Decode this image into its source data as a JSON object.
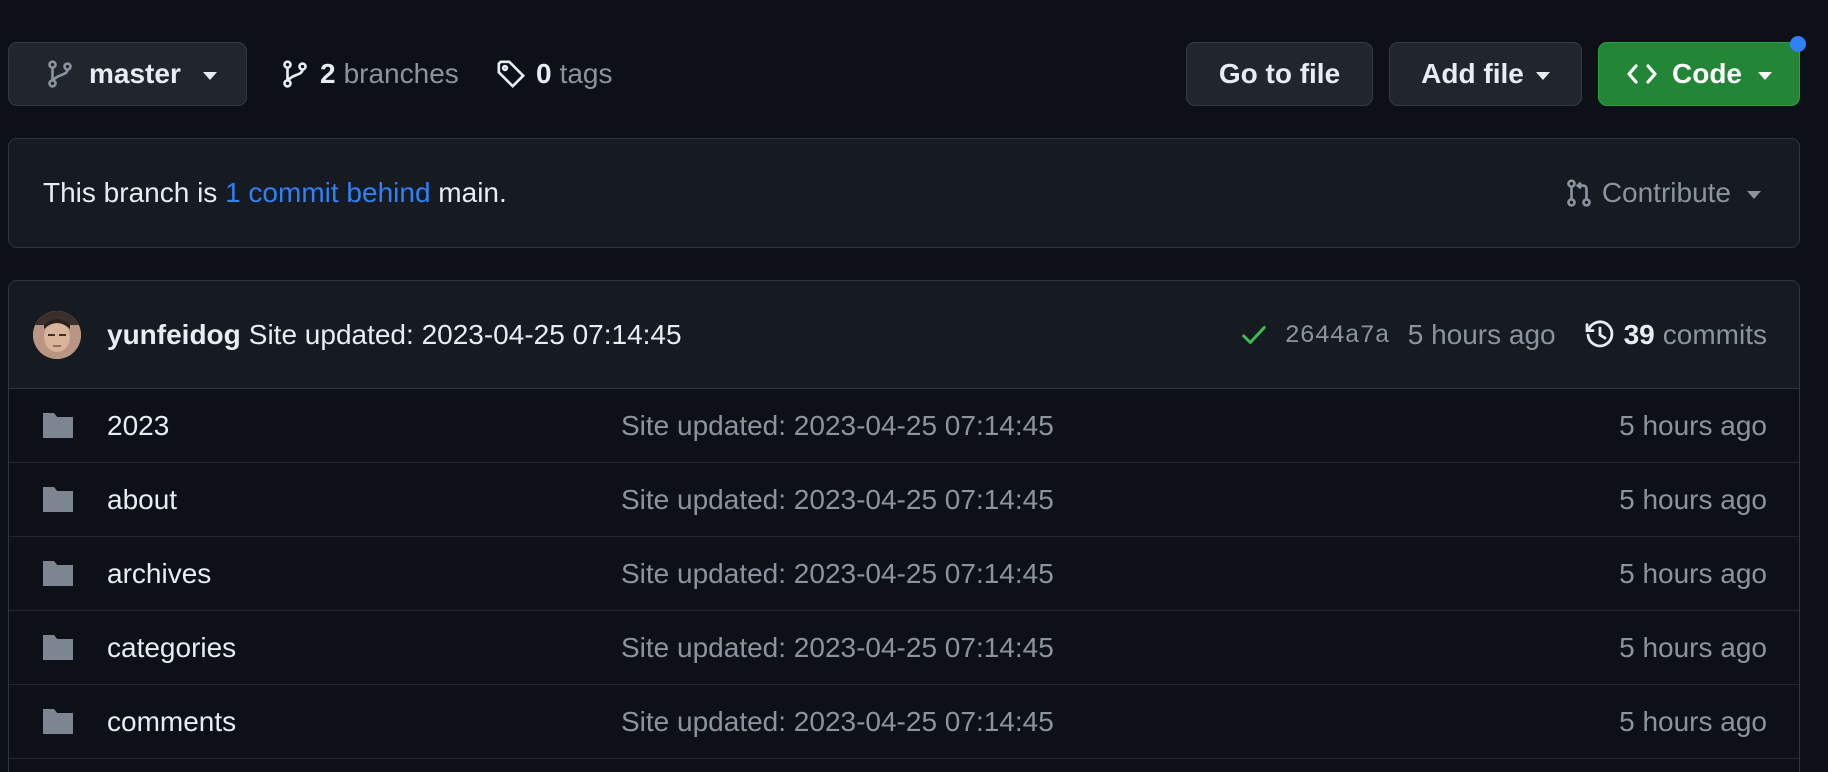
{
  "colors": {
    "background": "#0d1117",
    "panel": "#161b22",
    "accent_link": "#2f81f7",
    "code_button": "#238636",
    "success_check": "#3fb950",
    "folder_icon": "#7d8590"
  },
  "toolbar": {
    "branch_icon": "git-branch-icon",
    "branch_name": "master",
    "branches_count": "2",
    "branches_label": "branches",
    "tags_icon": "tag-icon",
    "tags_count": "0",
    "tags_label": "tags",
    "goto_file_label": "Go to file",
    "add_file_label": "Add file",
    "code_icon": "code-brackets-icon",
    "code_label": "Code"
  },
  "branch_status": {
    "prefix": "This branch is",
    "link": "1 commit behind",
    "suffix": "main.",
    "contribute_icon": "pull-request-icon",
    "contribute_label": "Contribute"
  },
  "latest_commit": {
    "author": "yunfeidog",
    "message": "Site updated: 2023-04-25 07:14:45",
    "status_icon": "check-icon",
    "sha": "2644a7a",
    "age": "5 hours ago",
    "history_icon": "history-icon",
    "commits_count": "39",
    "commits_label": "commits"
  },
  "files": [
    {
      "icon": "folder-icon",
      "name": "2023",
      "message": "Site updated: 2023-04-25 07:14:45",
      "age": "5 hours ago"
    },
    {
      "icon": "folder-icon",
      "name": "about",
      "message": "Site updated: 2023-04-25 07:14:45",
      "age": "5 hours ago"
    },
    {
      "icon": "folder-icon",
      "name": "archives",
      "message": "Site updated: 2023-04-25 07:14:45",
      "age": "5 hours ago"
    },
    {
      "icon": "folder-icon",
      "name": "categories",
      "message": "Site updated: 2023-04-25 07:14:45",
      "age": "5 hours ago"
    },
    {
      "icon": "folder-icon",
      "name": "comments",
      "message": "Site updated: 2023-04-25 07:14:45",
      "age": "5 hours ago"
    }
  ]
}
